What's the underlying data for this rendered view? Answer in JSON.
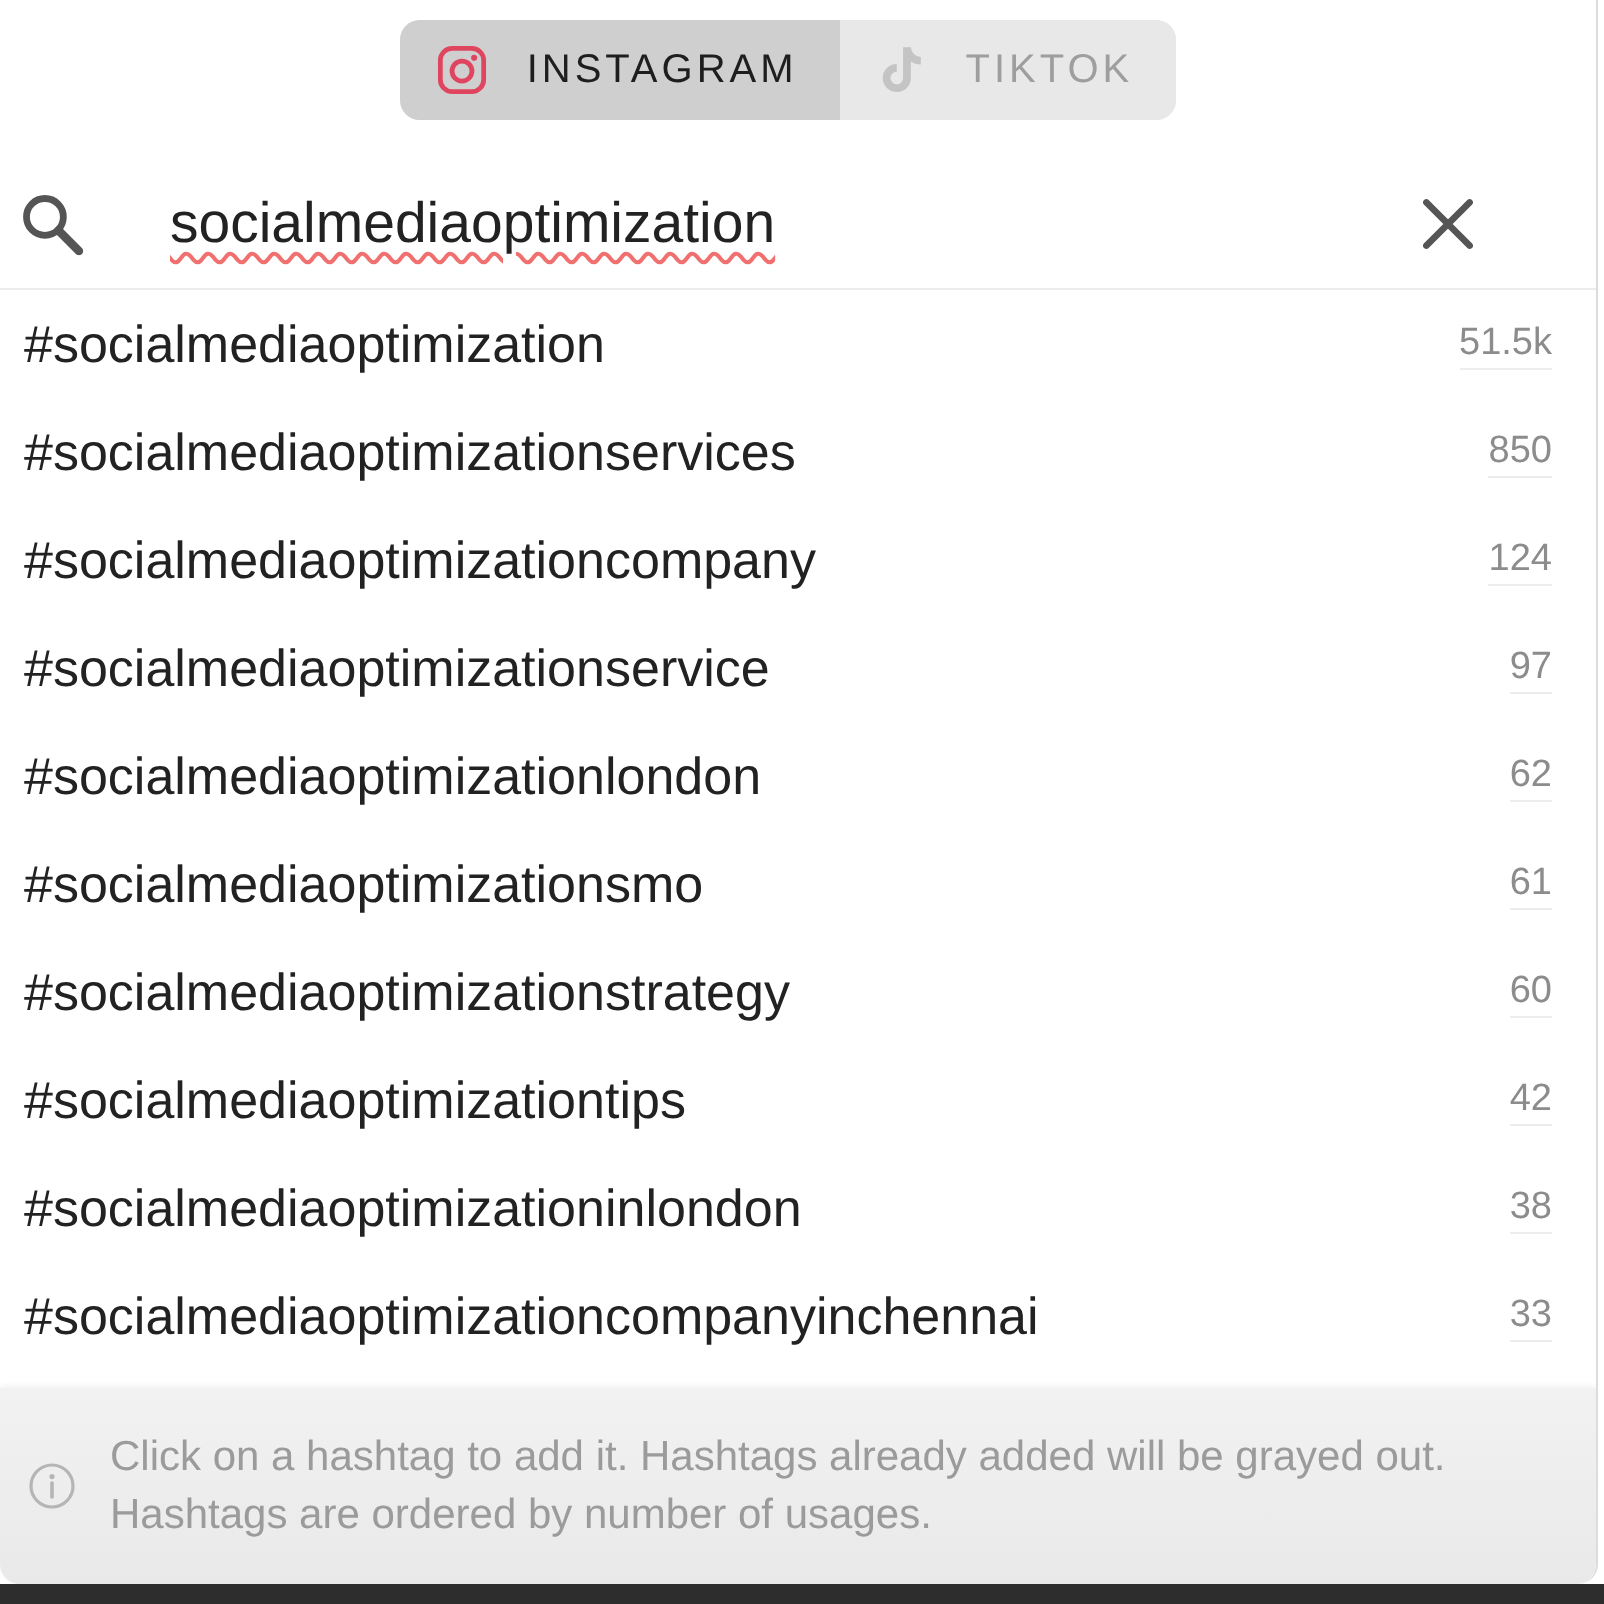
{
  "tabs": [
    {
      "label": "INSTAGRAM",
      "kind": "instagram",
      "selected": true
    },
    {
      "label": "TIKTOK",
      "kind": "tiktok",
      "selected": false
    }
  ],
  "search": {
    "value": "socialmediaoptimization",
    "misspelled": true
  },
  "hashtags": [
    {
      "tag": "#socialmediaoptimization",
      "count": "51.5k"
    },
    {
      "tag": "#socialmediaoptimizationservices",
      "count": "850"
    },
    {
      "tag": "#socialmediaoptimizationcompany",
      "count": "124"
    },
    {
      "tag": "#socialmediaoptimizationservice",
      "count": "97"
    },
    {
      "tag": "#socialmediaoptimizationlondon",
      "count": "62"
    },
    {
      "tag": "#socialmediaoptimizationsmo",
      "count": "61"
    },
    {
      "tag": "#socialmediaoptimizationstrategy",
      "count": "60"
    },
    {
      "tag": "#socialmediaoptimizationtips",
      "count": "42"
    },
    {
      "tag": "#socialmediaoptimizationinlondon",
      "count": "38"
    },
    {
      "tag": "#socialmediaoptimizationcompanyinchennai",
      "count": "33"
    }
  ],
  "footer": {
    "text": "Click on a hashtag to add it. Hashtags already added will be grayed out. Hashtags are ordered by number of usages."
  }
}
